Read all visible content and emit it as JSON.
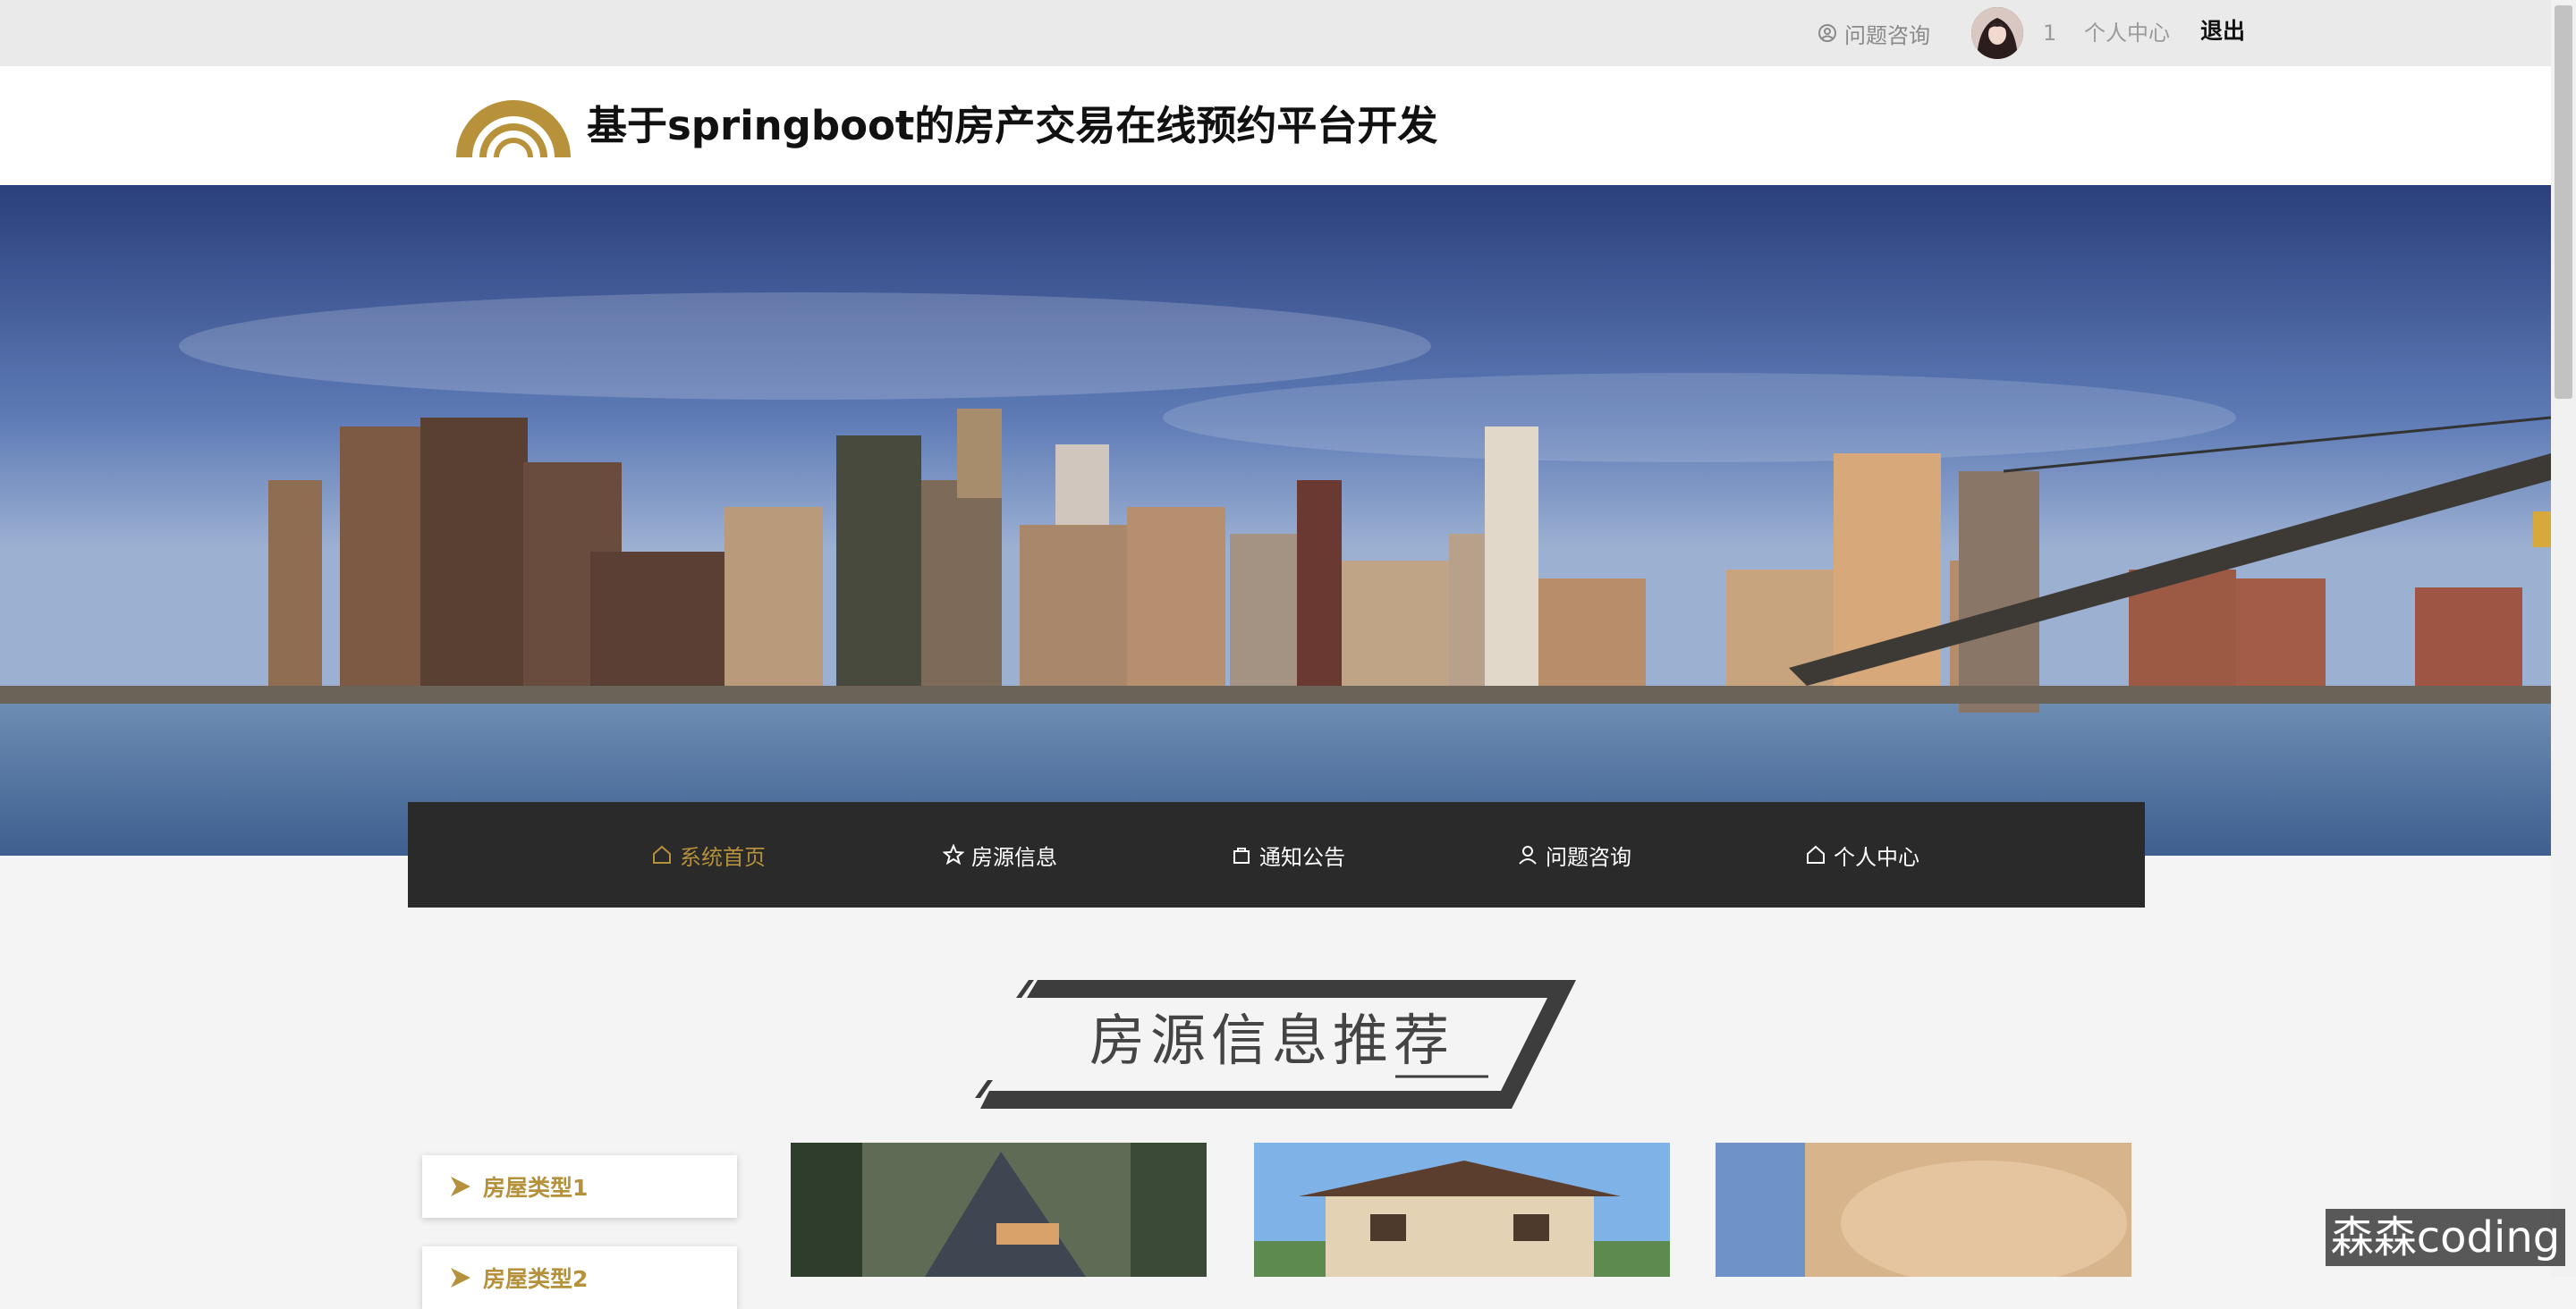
{
  "topbar": {
    "consult_label": "问题咨询",
    "username": "1",
    "center_label": "个人中心",
    "logout_label": "退出"
  },
  "header": {
    "title": "基于springboot的房产交易在线预约平台开发"
  },
  "nav": {
    "items": [
      {
        "label": "系统首页",
        "icon": "home-icon"
      },
      {
        "label": "房源信息",
        "icon": "star-icon"
      },
      {
        "label": "通知公告",
        "icon": "bag-icon"
      },
      {
        "label": "问题咨询",
        "icon": "user-icon"
      },
      {
        "label": "个人中心",
        "icon": "home-icon"
      }
    ]
  },
  "section": {
    "title": "房源信息推荐"
  },
  "categories": [
    {
      "label": "房屋类型1"
    },
    {
      "label": "房屋类型2"
    }
  ],
  "watermark": "森森coding",
  "colors": {
    "accent": "#b4913a",
    "nav_bg": "#2a2a2a",
    "topbar_bg": "#eaeaea"
  }
}
